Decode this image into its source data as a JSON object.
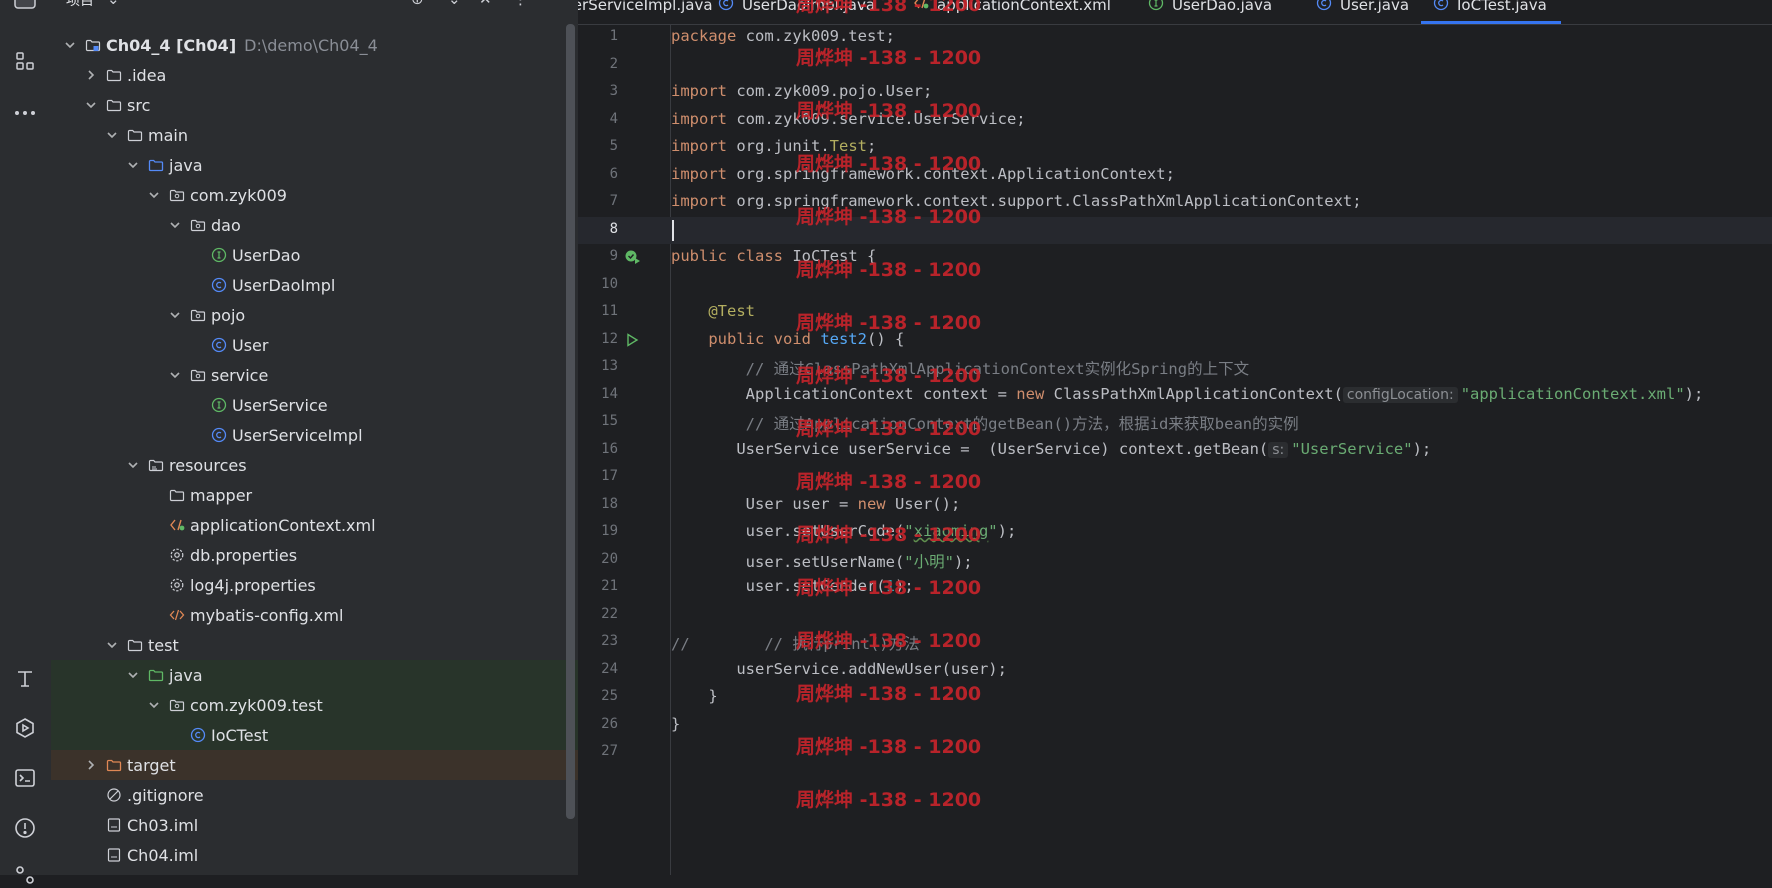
{
  "sidebar": {
    "title": "项目",
    "tree": [
      {
        "depth": 0,
        "expanded": true,
        "icon": "module-icon",
        "label": "Ch04_4 [Ch04]",
        "path": "D:\\demo\\Ch04_4",
        "bold": true
      },
      {
        "depth": 1,
        "expanded": false,
        "icon": "folder-icon",
        "label": ".idea"
      },
      {
        "depth": 1,
        "expanded": true,
        "icon": "folder-icon",
        "label": "src"
      },
      {
        "depth": 2,
        "expanded": true,
        "icon": "folder-icon",
        "label": "main"
      },
      {
        "depth": 3,
        "expanded": true,
        "icon": "source-folder-icon",
        "label": "java"
      },
      {
        "depth": 4,
        "expanded": true,
        "icon": "package-icon",
        "label": "com.zyk009"
      },
      {
        "depth": 5,
        "expanded": true,
        "icon": "package-icon",
        "label": "dao"
      },
      {
        "depth": 6,
        "icon": "interface-icon",
        "label": "UserDao"
      },
      {
        "depth": 6,
        "icon": "class-icon",
        "label": "UserDaoImpl"
      },
      {
        "depth": 5,
        "expanded": true,
        "icon": "package-icon",
        "label": "pojo"
      },
      {
        "depth": 6,
        "icon": "class-icon",
        "label": "User"
      },
      {
        "depth": 5,
        "expanded": true,
        "icon": "package-icon",
        "label": "service"
      },
      {
        "depth": 6,
        "icon": "interface-icon",
        "label": "UserService"
      },
      {
        "depth": 6,
        "icon": "class-icon",
        "label": "UserServiceImpl"
      },
      {
        "depth": 3,
        "expanded": true,
        "icon": "resources-folder-icon",
        "label": "resources"
      },
      {
        "depth": 4,
        "icon": "folder-icon",
        "label": "mapper"
      },
      {
        "depth": 4,
        "icon": "xml-spring-icon",
        "label": "applicationContext.xml"
      },
      {
        "depth": 4,
        "icon": "properties-icon",
        "label": "db.properties"
      },
      {
        "depth": 4,
        "icon": "properties-icon",
        "label": "log4j.properties"
      },
      {
        "depth": 4,
        "icon": "xml-icon",
        "label": "mybatis-config.xml"
      },
      {
        "depth": 2,
        "expanded": true,
        "icon": "folder-icon",
        "label": "test"
      },
      {
        "depth": 3,
        "expanded": true,
        "icon": "test-folder-icon",
        "label": "java",
        "variant": "test"
      },
      {
        "depth": 4,
        "expanded": true,
        "icon": "package-icon",
        "label": "com.zyk009.test",
        "variant": "test"
      },
      {
        "depth": 5,
        "icon": "class-icon",
        "label": "IoCTest",
        "variant": "test"
      },
      {
        "depth": 1,
        "expanded": false,
        "icon": "excluded-folder-icon",
        "label": "target",
        "variant": "excl"
      },
      {
        "depth": 1,
        "icon": "ignore-icon",
        "label": ".gitignore"
      },
      {
        "depth": 1,
        "icon": "iml-icon",
        "label": "Ch03.iml"
      },
      {
        "depth": 1,
        "icon": "iml-icon",
        "label": "Ch04.iml"
      }
    ]
  },
  "tabs": [
    {
      "label": "UserServiceImpl.java",
      "icon": "class-icon"
    },
    {
      "label": "UserDaoImpl.java",
      "icon": "class-icon"
    },
    {
      "label": "applicationContext.xml",
      "icon": "xml-spring-icon"
    },
    {
      "label": "UserDao.java",
      "icon": "interface-icon"
    },
    {
      "label": "User.java",
      "icon": "class-icon"
    },
    {
      "label": "IoCTest.java",
      "icon": "class-icon",
      "active": true
    }
  ],
  "editor": {
    "current_line": 8,
    "lines": [
      {
        "n": "1",
        "tokens": [
          [
            "kw",
            "package "
          ],
          [
            "",
            "com.zyk009.test;"
          ]
        ]
      },
      {
        "n": "2",
        "tokens": []
      },
      {
        "n": "3",
        "tokens": [
          [
            "kw",
            "import "
          ],
          [
            "",
            "com.zyk009.pojo.User;"
          ]
        ]
      },
      {
        "n": "4",
        "tokens": [
          [
            "kw",
            "import "
          ],
          [
            "",
            "com.zyk009.service.UserService;"
          ]
        ]
      },
      {
        "n": "5",
        "tokens": [
          [
            "kw",
            "import "
          ],
          [
            "",
            "org.junit."
          ],
          [
            "an",
            "Test"
          ],
          [
            "",
            ";"
          ]
        ]
      },
      {
        "n": "6",
        "tokens": [
          [
            "kw",
            "import "
          ],
          [
            "",
            "org.springframework.context.ApplicationContext;"
          ]
        ]
      },
      {
        "n": "7",
        "tokens": [
          [
            "kw",
            "import "
          ],
          [
            "",
            "org.springframework.context.support.ClassPathXmlApplicationContext;"
          ]
        ]
      },
      {
        "n": "8",
        "tokens": []
      },
      {
        "n": "9",
        "gutter": "run-class-icon",
        "tokens": [
          [
            "kw",
            "public class "
          ],
          [
            "",
            "IoCTest {"
          ]
        ]
      },
      {
        "n": "10",
        "tokens": []
      },
      {
        "n": "11",
        "tokens": [
          [
            "",
            "    "
          ],
          [
            "an",
            "@Test"
          ]
        ]
      },
      {
        "n": "12",
        "gutter": "run-icon",
        "tokens": [
          [
            "",
            "    "
          ],
          [
            "kw",
            "public void "
          ],
          [
            "fn",
            "test2"
          ],
          [
            "",
            "() {"
          ]
        ]
      },
      {
        "n": "13",
        "tokens": [
          [
            "",
            "        "
          ],
          [
            "cm",
            "// 通过ClassPathXmlApplicationContext实例化Spring的上下文"
          ]
        ]
      },
      {
        "n": "14",
        "tokens": [
          [
            "",
            "        ApplicationContext context = "
          ],
          [
            "kw",
            "new "
          ],
          [
            "",
            "ClassPathXmlApplicationContext("
          ],
          [
            "hint",
            "configLocation:"
          ],
          [
            "str",
            "\"applicationContext.xml\""
          ],
          [
            "",
            ");"
          ]
        ]
      },
      {
        "n": "15",
        "tokens": [
          [
            "",
            "        "
          ],
          [
            "cm",
            "// 通过ApplicationContext的getBean()方法，根据id来获取bean的实例"
          ]
        ]
      },
      {
        "n": "16",
        "tokens": [
          [
            "",
            "       UserService userService =  (UserService) context.getBean("
          ],
          [
            "hint",
            "s:"
          ],
          [
            "str",
            "\"UserService\""
          ],
          [
            "",
            ");"
          ]
        ]
      },
      {
        "n": "17",
        "tokens": []
      },
      {
        "n": "18",
        "tokens": [
          [
            "",
            "        User user = "
          ],
          [
            "kw",
            "new "
          ],
          [
            "",
            "User();"
          ]
        ]
      },
      {
        "n": "19",
        "tokens": [
          [
            "",
            "        user.setUserCode("
          ],
          [
            "str",
            "\""
          ],
          [
            "sq",
            "xiaoming"
          ],
          [
            "str",
            "\""
          ],
          [
            "",
            ");"
          ]
        ]
      },
      {
        "n": "20",
        "tokens": [
          [
            "",
            "        user.setUserName("
          ],
          [
            "str",
            "\"小明\""
          ],
          [
            "",
            ");"
          ]
        ]
      },
      {
        "n": "21",
        "tokens": [
          [
            "",
            "        user.setGender("
          ],
          [
            "num2",
            "1"
          ],
          [
            "",
            ");"
          ]
        ]
      },
      {
        "n": "22",
        "tokens": []
      },
      {
        "n": "23",
        "tokens": [
          [
            "cm",
            "//        // 执行print()方法"
          ]
        ]
      },
      {
        "n": "24",
        "tokens": [
          [
            "",
            "       userService.addNewUser(user);"
          ]
        ]
      },
      {
        "n": "25",
        "tokens": [
          [
            "",
            "    }"
          ]
        ]
      },
      {
        "n": "26",
        "tokens": [
          [
            "",
            "}"
          ]
        ]
      },
      {
        "n": "27",
        "tokens": []
      }
    ]
  },
  "watermark": {
    "text": "周烨坤 -138 - 1200",
    "color": "#c9242b",
    "repeat": 16
  }
}
